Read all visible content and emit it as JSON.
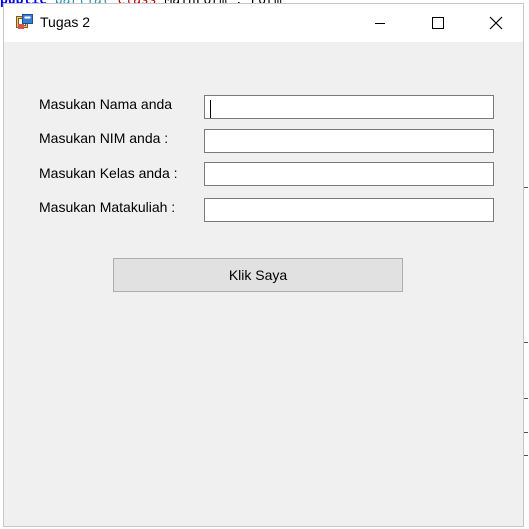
{
  "background_code": {
    "kw1": "public",
    "kw2": "partial",
    "kw3": "class",
    "rest": "MainForm : Form"
  },
  "window": {
    "title": "Tugas 2",
    "icon": "winforms-app-icon",
    "controls": {
      "minimize": "minimize-icon",
      "maximize": "maximize-icon",
      "close": "close-icon"
    }
  },
  "form": {
    "fields": [
      {
        "label": "Masukan Nama anda",
        "value": ""
      },
      {
        "label": "Masukan NIM anda :",
        "value": ""
      },
      {
        "label": "Masukan Kelas anda :",
        "value": ""
      },
      {
        "label": "Masukan Matakuliah :",
        "value": ""
      }
    ],
    "button_label": "Klik Saya"
  },
  "colors": {
    "window_bg": "#f0f0f0",
    "titlebar_bg": "#ffffff",
    "button_bg": "#e1e1e1",
    "button_border": "#adadad"
  }
}
